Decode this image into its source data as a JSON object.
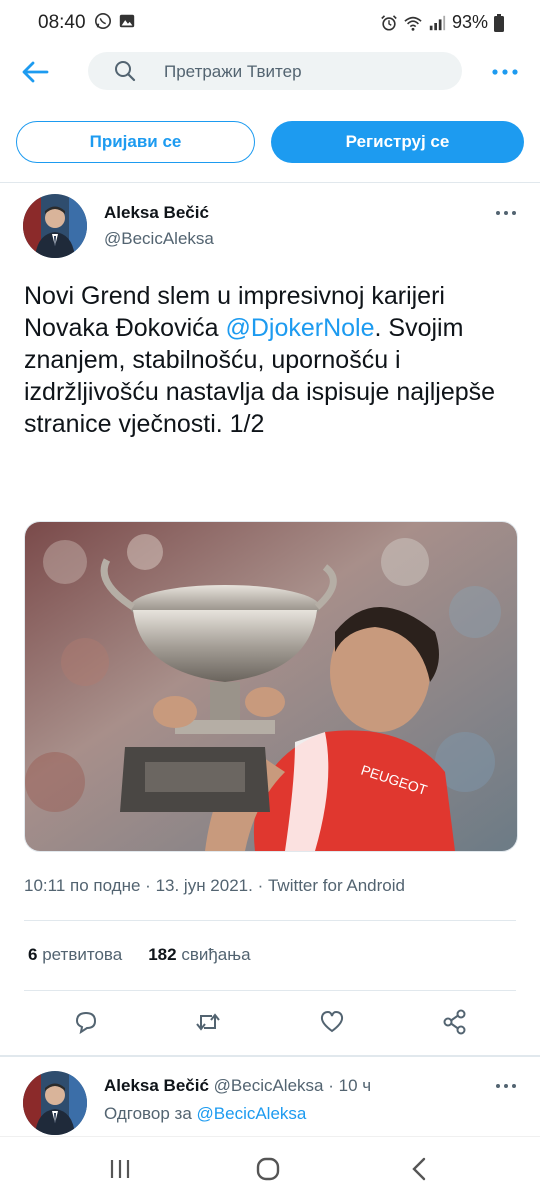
{
  "status_bar": {
    "time": "08:40",
    "battery": "93%"
  },
  "search": {
    "placeholder": "Претражи Твитер"
  },
  "auth": {
    "login_label": "Пријави се",
    "signup_label": "Региструј се"
  },
  "tweet": {
    "author_name": "Aleksa Bečić",
    "author_handle": "@BecicAleksa",
    "text_before": "Novi Grend slem u impresivnoj karijeri Novaka Đokovića ",
    "mention": "@DjokerNole",
    "text_after": ". Svojim znanjem, stabilnošću, upornošću i izdržljivošću nastavlja da ispisuje najljepše stranice vječnosti. 1/2",
    "time": "10:11 по подне",
    "date": "13. јун 2021.",
    "source": "Twitter for Android",
    "retweets_count": "6",
    "retweets_label": "ретвитова",
    "likes_count": "182",
    "likes_label": "свиђања"
  },
  "reply_tweet": {
    "author_name": "Aleksa Bečić",
    "author_handle": "@BecicAleksa",
    "age": "10 ч",
    "reply_prefix": "Одговор за",
    "reply_to": "@BecicAleksa"
  },
  "colors": {
    "accent": "#1d9bf0",
    "text_primary": "#0f1419",
    "text_secondary": "#536471"
  }
}
